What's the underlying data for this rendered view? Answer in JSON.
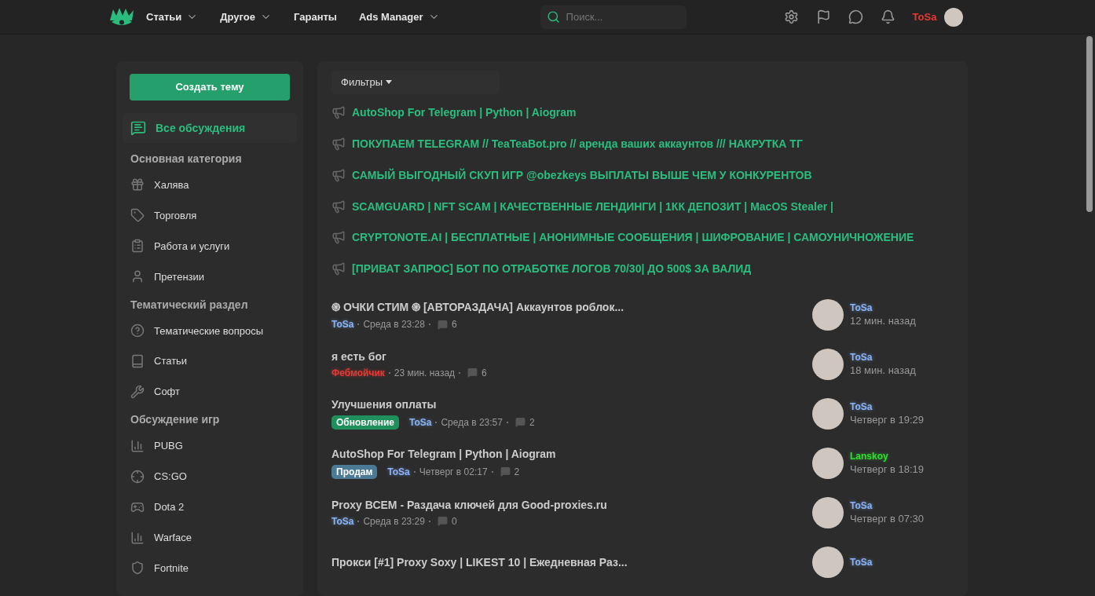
{
  "header": {
    "nav": [
      {
        "label": "Статьи",
        "dropdown": true
      },
      {
        "label": "Другое",
        "dropdown": true
      },
      {
        "label": "Гаранты",
        "dropdown": false
      },
      {
        "label": "Ads Manager",
        "dropdown": true
      }
    ],
    "search": {
      "placeholder": "Поиск..."
    },
    "user": {
      "name": "ToSa"
    }
  },
  "sidebar": {
    "create_button": "Создать тему",
    "all": {
      "label": "Все обсуждения",
      "selected": true
    },
    "sections": [
      {
        "title": "Основная категория",
        "items": [
          {
            "label": "Халява",
            "selected": false
          },
          {
            "label": "Торговля",
            "selected": false
          },
          {
            "label": "Работа и услуги",
            "selected": false
          },
          {
            "label": "Претензии",
            "selected": false
          }
        ]
      },
      {
        "title": "Тематический раздел",
        "items": [
          {
            "label": "Тематические вопросы",
            "selected": false
          },
          {
            "label": "Статьи",
            "selected": false
          },
          {
            "label": "Софт",
            "selected": false
          }
        ]
      },
      {
        "title": "Обсуждение игр",
        "items": [
          {
            "label": "PUBG",
            "selected": false
          },
          {
            "label": "CS:GO",
            "selected": false
          },
          {
            "label": "Dota 2",
            "selected": false
          },
          {
            "label": "Warface",
            "selected": false
          },
          {
            "label": "Fortnite",
            "selected": false
          }
        ]
      }
    ]
  },
  "main": {
    "filters": "Фильтры",
    "pinned": [
      "AutoShop For Telegram | Python | Aiogram",
      "ПОКУПАЕМ TELEGRAM // TeaTeaBot.pro // аренда ваших аккаунтов /// НАКРУТКА ТГ",
      "САМЫЙ ВЫГОДНЫЙ СКУП ИГР @obezkeys ВЫПЛАТЫ ВЫШЕ ЧЕМ У КОНКУРЕНТОВ",
      "SCAMGUARD | NFT SCAM | КАЧЕСТВЕННЫЕ ЛЕНДИНГИ | 1КК ДЕПОЗИТ | MacOS Stealer |",
      "CRYPTONOTE.AI | БЕСПЛАТНЫЕ | АНОНИМНЫЕ СООБЩЕНИЯ | ШИФРОВАНИЕ | САМОУНИЧНОЖЕНИЕ",
      "[ПРИВАТ ЗАПРОС] БОТ ПО ОТРАБОТКЕ ЛОГОВ 70/30| ДО 500$ ЗА ВАЛИД"
    ],
    "threads": [
      {
        "title": "֍ ОЧКИ СТИМ ֍ [АВТОРАЗДАЧА] Аккаунтов роблок...",
        "author": {
          "name": "ToSa",
          "color": "#8ab4f8"
        },
        "time": "Среда в 23:28",
        "replies": "6",
        "last": {
          "name": "ToSa",
          "color": "#8ab4f8",
          "time": "12 мин. назад"
        }
      },
      {
        "title": "я есть бог",
        "author": {
          "name": "Фебмойчик",
          "color": "#e53935"
        },
        "time": "23 мин. назад",
        "replies": "6",
        "last": {
          "name": "ToSa",
          "color": "#8ab4f8",
          "time": "18 мин. назад"
        }
      },
      {
        "title": "Улучшения оплаты",
        "tag": {
          "label": "Обновление",
          "kind": "update"
        },
        "author": {
          "name": "ToSa",
          "color": "#8ab4f8"
        },
        "time": "Среда в 23:57",
        "replies": "2",
        "last": {
          "name": "ToSa",
          "color": "#8ab4f8",
          "time": "Четверг в 19:29"
        }
      },
      {
        "title": "AutoShop For Telegram | Python | Aiogram",
        "tag": {
          "label": "Продам",
          "kind": "sell"
        },
        "author": {
          "name": "ToSa",
          "color": "#8ab4f8"
        },
        "time": "Четверг в 02:17",
        "replies": "2",
        "last": {
          "name": "Lanskoy",
          "color": "#33dd33",
          "time": "Четверг в 18:19"
        }
      },
      {
        "title": "Proxy ВСЕМ - Раздача ключей для Good-proxies.ru",
        "author": {
          "name": "ToSa",
          "color": "#8ab4f8"
        },
        "time": "Среда в 23:29",
        "replies": "0",
        "last": {
          "name": "ToSa",
          "color": "#8ab4f8",
          "time": "Четверг в 07:30"
        }
      },
      {
        "title": "Прокси [#1] Proxy Soxy | LIKEST 10 | Ежедневная Раз...",
        "last": {
          "name": "ToSa",
          "color": "#8ab4f8"
        }
      }
    ]
  }
}
